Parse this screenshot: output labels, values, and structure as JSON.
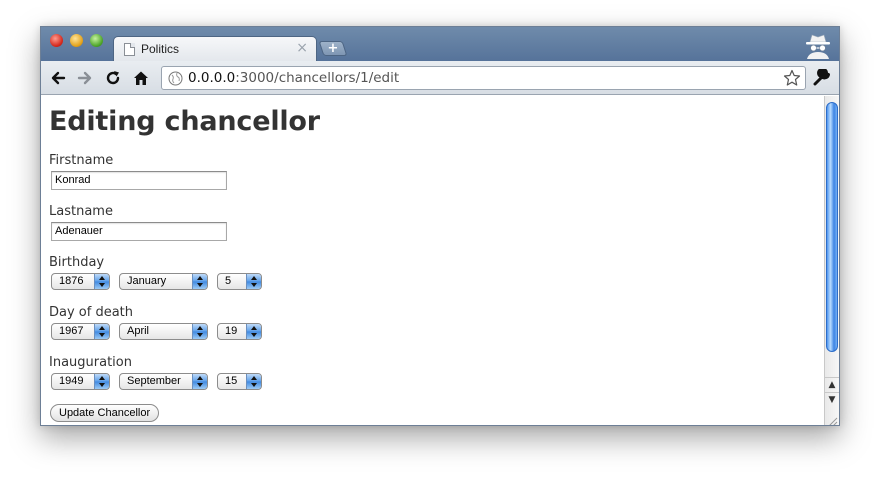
{
  "browser": {
    "tab_title": "Politics",
    "tab_close_glyph": "×",
    "new_tab_glyph": "+",
    "url_host": "0.0.0.0",
    "url_rest": ":3000/chancellors/1/edit",
    "icons": [
      "back-arrow-icon",
      "forward-arrow-icon",
      "reload-icon",
      "home-icon",
      "globe-icon",
      "bookmark-star-icon",
      "wrench-icon",
      "incognito-icon",
      "page-icon"
    ]
  },
  "page": {
    "title": "Editing chancellor",
    "firstname": {
      "label": "Firstname",
      "value": "Konrad"
    },
    "lastname": {
      "label": "Lastname",
      "value": "Adenauer"
    },
    "birthday": {
      "label": "Birthday",
      "year": "1876",
      "month": "January",
      "day": "5"
    },
    "day_of_death": {
      "label": "Day of death",
      "year": "1967",
      "month": "April",
      "day": "19"
    },
    "inauguration": {
      "label": "Inauguration",
      "year": "1949",
      "month": "September",
      "day": "15"
    },
    "submit_label": "Update Chancellor"
  },
  "scrollbar": {
    "up_glyph": "▲",
    "down_glyph": "▼"
  },
  "colors": {
    "titlebar": "#5f7da3",
    "scroll_thumb": "#3c84e4",
    "select_arrow": "#5b9ee9"
  }
}
